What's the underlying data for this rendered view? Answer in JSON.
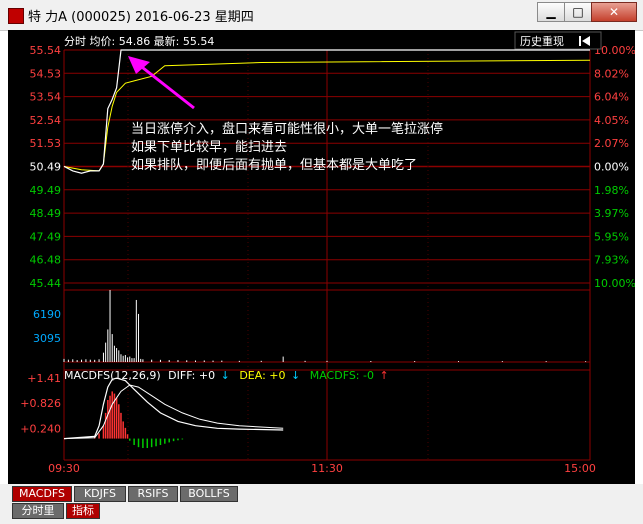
{
  "window": {
    "title": "特 力A (000025) 2016-06-23 星期四",
    "min_label": "▁",
    "max_label": "□",
    "close_label": "✕"
  },
  "chart_header": {
    "label": "分时 均价: 54.86 最新: 55.54",
    "history_button": "历史重现",
    "history_icon": "skip-back-icon"
  },
  "annotation": {
    "lines": [
      "当日涨停介入，盘口来看可能性很小，大单一笔拉涨停",
      "如果下单比较早，能扫进去",
      "如果排队，即便后面有抛单，但基本都是大单吃了"
    ],
    "arrow_color": "#ff00ff"
  },
  "macd_header": {
    "name": "MACDFS(12,26,9)",
    "diff": "DIFF: +0",
    "dea": "DEA: +0",
    "macdfs": "MACDFS: -0"
  },
  "tabs": {
    "macdfs": "MACDFS",
    "kdjfs": "KDJFS",
    "rsifs": "RSIFS",
    "bollfs": "BOLLFS",
    "fenshi": "分时里",
    "zhibiao": "指标"
  },
  "colors": {
    "up": "#ff3333",
    "down": "#00cc00",
    "axis_red": "#cc0000",
    "price_line": "#ffffff",
    "avg_line": "#ffff00",
    "volume_bar": "#ffffff",
    "grid": "#8b0000"
  },
  "chart_data": [
    {
      "type": "line",
      "title": "分时",
      "price_ticks": [
        "55.54",
        "54.53",
        "53.54",
        "52.54",
        "51.53",
        "50.49",
        "49.49",
        "48.49",
        "47.49",
        "46.48",
        "45.44"
      ],
      "percent_ticks": [
        "10.00%",
        "8.02%",
        "6.04%",
        "4.05%",
        "2.07%",
        "0.00%",
        "1.98%",
        "3.97%",
        "5.95%",
        "7.93%",
        "10.00%"
      ],
      "ylim": [
        45.44,
        55.54
      ],
      "xlim": [
        0,
        240
      ],
      "time_ticks": [
        "09:30",
        "11:30",
        "15:00"
      ],
      "series": [
        {
          "values": [
            [
              0,
              50.5
            ],
            [
              4,
              50.3
            ],
            [
              8,
              50.2
            ],
            [
              12,
              50.3
            ],
            [
              16,
              50.3
            ],
            [
              18,
              50.6
            ],
            [
              20,
              53.0
            ],
            [
              22,
              53.4
            ],
            [
              24,
              53.9
            ],
            [
              26,
              55.54
            ],
            [
              30,
              55.54
            ],
            [
              240,
              55.54
            ]
          ]
        },
        {
          "values": [
            [
              0,
              50.49
            ],
            [
              8,
              50.35
            ],
            [
              16,
              50.3
            ],
            [
              18,
              50.6
            ],
            [
              20,
              52.2
            ],
            [
              22,
              53.1
            ],
            [
              24,
              53.7
            ],
            [
              28,
              54.1
            ],
            [
              32,
              54.2
            ],
            [
              40,
              54.4
            ],
            [
              46,
              54.86
            ],
            [
              90,
              55.0
            ],
            [
              240,
              55.1
            ]
          ]
        }
      ]
    },
    {
      "type": "bar",
      "title": "成交量",
      "volume_ticks": [
        "6190",
        "3095"
      ],
      "ylim": [
        0,
        9285
      ],
      "values": [
        [
          0,
          400
        ],
        [
          2,
          300
        ],
        [
          4,
          350
        ],
        [
          6,
          250
        ],
        [
          8,
          300
        ],
        [
          10,
          350
        ],
        [
          12,
          300
        ],
        [
          14,
          280
        ],
        [
          16,
          350
        ],
        [
          18,
          1200
        ],
        [
          19,
          2500
        ],
        [
          20,
          4200
        ],
        [
          21,
          9285
        ],
        [
          22,
          3600
        ],
        [
          23,
          2100
        ],
        [
          24,
          1800
        ],
        [
          25,
          1500
        ],
        [
          26,
          1000
        ],
        [
          27,
          800
        ],
        [
          28,
          900
        ],
        [
          29,
          600
        ],
        [
          30,
          700
        ],
        [
          31,
          500
        ],
        [
          32,
          500
        ],
        [
          33,
          8000
        ],
        [
          34,
          6200
        ],
        [
          35,
          400
        ],
        [
          36,
          350
        ],
        [
          40,
          300
        ],
        [
          44,
          280
        ],
        [
          48,
          250
        ],
        [
          52,
          250
        ],
        [
          56,
          220
        ],
        [
          60,
          200
        ],
        [
          64,
          200
        ],
        [
          68,
          180
        ],
        [
          72,
          180
        ],
        [
          80,
          150
        ],
        [
          90,
          150
        ],
        [
          100,
          700
        ],
        [
          110,
          150
        ],
        [
          120,
          150
        ],
        [
          140,
          130
        ],
        [
          160,
          120
        ],
        [
          180,
          120
        ],
        [
          200,
          110
        ],
        [
          220,
          110
        ],
        [
          238,
          100
        ]
      ]
    },
    {
      "type": "bar",
      "title": "MACDFS(12,26,9)",
      "macd_ticks": [
        "+1.41",
        "+0.826",
        "+0.240"
      ],
      "ylim": [
        -0.5,
        1.6
      ],
      "values": [
        [
          14,
          0.05
        ],
        [
          16,
          0.12
        ],
        [
          18,
          0.3
        ],
        [
          19,
          0.6
        ],
        [
          20,
          0.9
        ],
        [
          21,
          1.0
        ],
        [
          22,
          1.1
        ],
        [
          23,
          1.05
        ],
        [
          24,
          0.95
        ],
        [
          25,
          0.8
        ],
        [
          26,
          0.6
        ],
        [
          27,
          0.4
        ],
        [
          28,
          0.25
        ],
        [
          29,
          0.1
        ],
        [
          30,
          -0.05
        ],
        [
          32,
          -0.15
        ],
        [
          34,
          -0.2
        ],
        [
          36,
          -0.22
        ],
        [
          38,
          -0.22
        ],
        [
          40,
          -0.2
        ],
        [
          42,
          -0.18
        ],
        [
          44,
          -0.15
        ],
        [
          46,
          -0.12
        ],
        [
          48,
          -0.09
        ],
        [
          50,
          -0.06
        ],
        [
          52,
          -0.04
        ],
        [
          54,
          -0.02
        ]
      ],
      "series": [
        {
          "values": [
            [
              0,
              0
            ],
            [
              14,
              0.05
            ],
            [
              16,
              0.3
            ],
            [
              18,
              0.8
            ],
            [
              20,
              1.2
            ],
            [
              22,
              1.38
            ],
            [
              24,
              1.41
            ],
            [
              28,
              1.35
            ],
            [
              32,
              1.15
            ],
            [
              38,
              0.85
            ],
            [
              44,
              0.6
            ],
            [
              52,
              0.4
            ],
            [
              60,
              0.3
            ],
            [
              70,
              0.24
            ],
            [
              80,
              0.22
            ],
            [
              100,
              0.2
            ]
          ]
        },
        {
          "values": [
            [
              0,
              0
            ],
            [
              14,
              0.02
            ],
            [
              18,
              0.3
            ],
            [
              22,
              0.8
            ],
            [
              26,
              1.1
            ],
            [
              30,
              1.25
            ],
            [
              34,
              1.2
            ],
            [
              40,
              1.0
            ],
            [
              46,
              0.8
            ],
            [
              54,
              0.6
            ],
            [
              62,
              0.45
            ],
            [
              70,
              0.36
            ],
            [
              80,
              0.3
            ],
            [
              100,
              0.24
            ]
          ]
        }
      ]
    }
  ]
}
